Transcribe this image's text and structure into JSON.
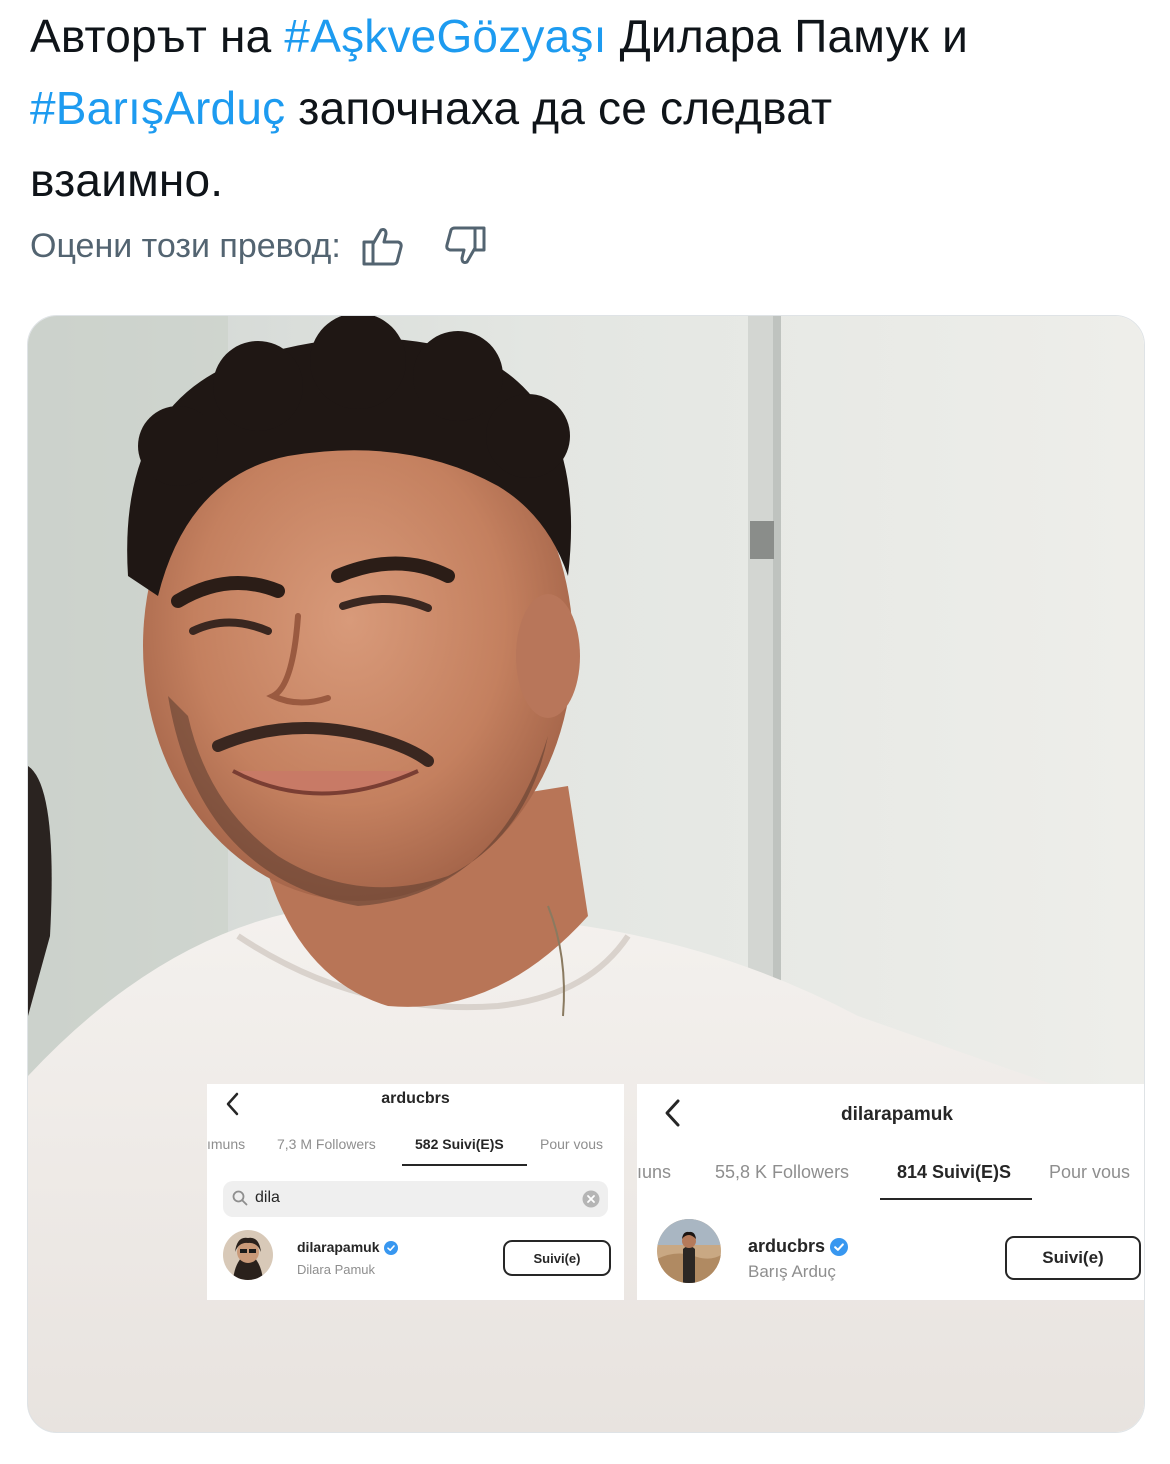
{
  "tweet": {
    "line1_prefix": "Авторът на ",
    "hashtag1": "#AşkveGözyaşı",
    "line1_suffix": " Дилара Памук и",
    "hashtag2": "#BarışArduç",
    "line2_suffix": " започнаха да се следват",
    "line3": "взаимно."
  },
  "translation_rating": {
    "label": "Оцени този превод:",
    "thumbs_up_icon": "thumbs-up-icon",
    "thumbs_down_icon": "thumbs-down-icon"
  },
  "screenshot_left": {
    "title": "arducbrs",
    "tabs": [
      "ımuns",
      "7,3 M Followers",
      "582 Suivi(E)S",
      "Pour vous"
    ],
    "active_tab": 2,
    "search_query": "dila",
    "result": {
      "username": "dilarapamuk",
      "full_name": "Dilara Pamuk",
      "button": "Suivi(e)"
    }
  },
  "screenshot_right": {
    "title": "dilarapamuk",
    "tabs": [
      "ıuns",
      "55,8 K Followers",
      "814 Suivi(E)S",
      "Pour vous"
    ],
    "active_tab": 2,
    "result": {
      "username": "arducbrs",
      "full_name": "Barış Arduç",
      "button": "Suivi(e)"
    }
  },
  "colors": {
    "hashtag": "#1d9bf0",
    "muted": "#536471",
    "verified": "#3897f0"
  }
}
